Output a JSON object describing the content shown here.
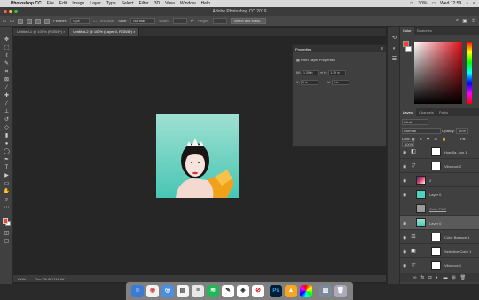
{
  "menubar": {
    "apple": "",
    "items": [
      "Photoshop CC",
      "File",
      "Edit",
      "Image",
      "Layer",
      "Type",
      "Select",
      "Filter",
      "3D",
      "View",
      "Window",
      "Help"
    ],
    "battery": "30%",
    "clock": "Wed 12:59"
  },
  "titlebar": {
    "title": "Adobe Photoshop CC 2019"
  },
  "options": {
    "feather_label": "Feather:",
    "feather_value": "0 px",
    "antialias_label": "Anti-alias",
    "style_label": "Style:",
    "style_value": "Normal",
    "width_label": "Width:",
    "height_label": "Height:",
    "select_mask": "Select and Mask..."
  },
  "tabs": [
    {
      "label": "Untitled-1 @ 100% (RGB/8*) ×"
    },
    {
      "label": "Untitled-2 @ 100% (Layer 0, RGB/8*) ×"
    }
  ],
  "properties": {
    "title": "Properties",
    "subtitle": "Pixel Layer Properties",
    "w_label": "W:",
    "w_value": "1.39 in",
    "h_label": "H:",
    "h_value": "1.39 in",
    "x_label": "X:",
    "x_value": "0 in",
    "y_label": "Y:",
    "y_value": "0 in"
  },
  "color_panel": {
    "tabs": [
      "Color",
      "Swatches"
    ]
  },
  "layers_panel": {
    "tabs": [
      "Layers",
      "Channels",
      "Paths"
    ],
    "kind": "Kind",
    "blend": "Normal",
    "opacity_label": "Opacity:",
    "opacity_value": "80%",
    "lock_label": "Lock:",
    "fill_label": "Fill:",
    "fill_value": "100%",
    "layers": [
      {
        "name": "Hue/Sa...ion 1"
      },
      {
        "name": "Vibrance 2"
      },
      {
        "name": "2"
      },
      {
        "name": "Layer 0"
      },
      {
        "name": "Color Fill 1"
      },
      {
        "name": "Layer 0"
      },
      {
        "name": "Color Balance 1"
      },
      {
        "name": "Selective Color 1"
      },
      {
        "name": "Vibrance 1"
      }
    ]
  },
  "status": {
    "zoom": "100%",
    "doc": "Doc: 29.9K/746.6K"
  },
  "colors": {
    "accent": "#31a8ff",
    "foreground": "#ff3b30",
    "background": "#ffffff"
  }
}
